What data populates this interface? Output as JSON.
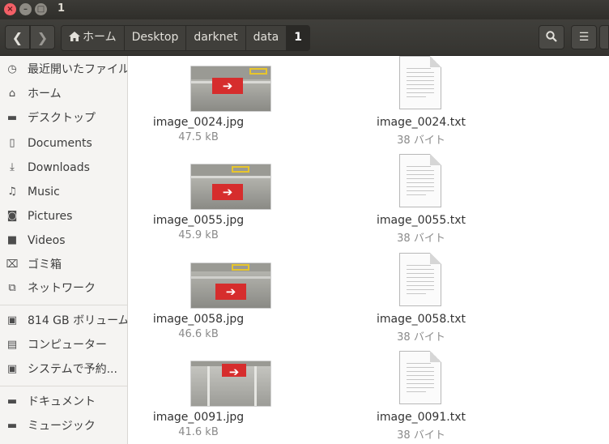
{
  "window": {
    "title": "1"
  },
  "breadcrumbs": [
    "ホーム",
    "Desktop",
    "darknet",
    "data",
    "1"
  ],
  "sidebar": {
    "items": [
      {
        "label": "最近開いたファイル",
        "icon": "clock-icon",
        "glyph": "◷"
      },
      {
        "label": "ホーム",
        "icon": "home-icon",
        "glyph": "⌂"
      },
      {
        "label": "デスクトップ",
        "icon": "folder-icon",
        "glyph": "▬"
      },
      {
        "label": "Documents",
        "icon": "document-icon",
        "glyph": "▯"
      },
      {
        "label": "Downloads",
        "icon": "download-icon",
        "glyph": "⤓"
      },
      {
        "label": "Music",
        "icon": "music-icon",
        "glyph": "♫"
      },
      {
        "label": "Pictures",
        "icon": "camera-icon",
        "glyph": "◙"
      },
      {
        "label": "Videos",
        "icon": "video-icon",
        "glyph": "■"
      },
      {
        "label": "ゴミ箱",
        "icon": "trash-icon",
        "glyph": "⌧"
      },
      {
        "label": "ネットワーク",
        "icon": "network-icon",
        "glyph": "⧉"
      },
      {
        "label": "814 GB ボリューム",
        "icon": "drive-icon",
        "glyph": "▣"
      },
      {
        "label": "コンピューター",
        "icon": "computer-icon",
        "glyph": "▤"
      },
      {
        "label": "システムで予約...",
        "icon": "drive-icon",
        "glyph": "▣"
      },
      {
        "label": "ドキュメント",
        "icon": "folder-icon",
        "glyph": "▬"
      },
      {
        "label": "ミュージック",
        "icon": "folder-icon",
        "glyph": "▬"
      }
    ]
  },
  "files": [
    {
      "name": "image_0024.jpg",
      "size": "47.5 kB",
      "kind": "image"
    },
    {
      "name": "image_0024.txt",
      "size": "38 バイト",
      "kind": "text"
    },
    {
      "name": "image_0055.jpg",
      "size": "45.9 kB",
      "kind": "image"
    },
    {
      "name": "image_0055.txt",
      "size": "38 バイト",
      "kind": "text"
    },
    {
      "name": "image_0058.jpg",
      "size": "46.6 kB",
      "kind": "image"
    },
    {
      "name": "image_0058.txt",
      "size": "38 バイト",
      "kind": "text"
    },
    {
      "name": "image_0091.jpg",
      "size": "41.6 kB",
      "kind": "image"
    },
    {
      "name": "image_0091.txt",
      "size": "38 バイト",
      "kind": "text"
    }
  ],
  "colors": {
    "sign_red": "#d62d2d",
    "tape_yellow": "#e7c52c",
    "titlebar": "#3c3b37"
  }
}
